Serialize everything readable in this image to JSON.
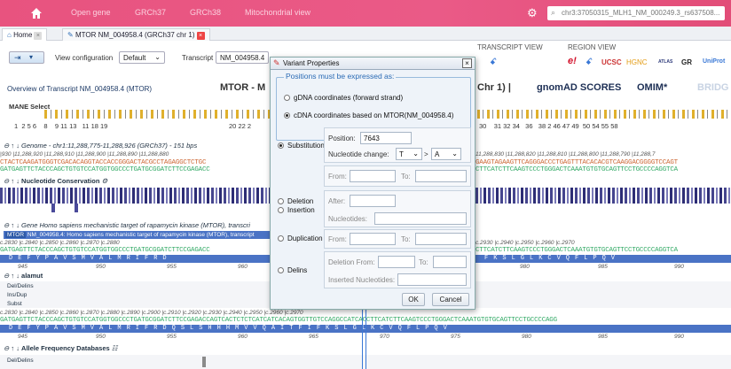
{
  "topbar": {
    "nav": [
      "Open gene",
      "GRCh37",
      "GRCh38",
      "Mitochondrial view"
    ],
    "search": "chr3:37050315_MLH1_NM_000249.3_rs637508..."
  },
  "tabs": [
    {
      "label": "Home"
    },
    {
      "label": "MTOR NM_004958.4 (GRCh37 chr 1)"
    }
  ],
  "toolbar": {
    "view_config_label": "View configuration",
    "view_config_value": "Default",
    "transcript_label": "Transcript",
    "transcript_value": "NM_004958.4",
    "transcript_view": "TRANSCRIPT VIEW",
    "region_view": "REGION VIEW",
    "links": [
      "UCSC",
      "HGNC",
      "ATLAS",
      "GR",
      "UniProt"
    ]
  },
  "overview": {
    "title": "Overview of Transcript NM_004958.4 (MTOR)",
    "gene": "MTOR - M",
    "chr": "Chr 1) |",
    "gnomad": "gnomAD SCORES",
    "omim": "OMIM*",
    "bridge": "BRIDG",
    "mane": "MANE Select"
  },
  "exons_left": [
    "1",
    "2",
    "5",
    "6",
    "8",
    "9",
    "11",
    "13",
    "11",
    "18",
    "19"
  ],
  "exons_right": [
    "20",
    "22",
    "2",
    "30",
    "31",
    "32",
    "34",
    "36",
    "38",
    "2",
    "46",
    "47",
    "49",
    "50",
    "54",
    "55",
    "58"
  ],
  "tracks": {
    "genome": "Genome - chr1:11,288,775-11,288,926 (GRCh37) - 151 bps",
    "conservation": "Nucleotide Conservation",
    "gene": "Gene Homo sapiens mechanistic target of rapamycin kinase (MTOR), transcri",
    "gene_banner": "NM_004958.4: Homo sapiens mechanistic target of rapamycin kinase (MTOR), transcript",
    "alamut": "alamut",
    "alamut_rows": [
      "Del/Delins",
      "Ins/Dup",
      "Subst"
    ],
    "allele": "Allele Frequency Databases",
    "allele_rows": [
      "Del/Delins"
    ],
    "mtor_badge": "MTOR"
  },
  "genome_ruler": "|930        |11,288,920        |11,288,910        |11,288,900        |11,288,890        |11,288,880",
  "genome_ruler_r": "11,288,830        |11,288,820        |11,288,810        |11,288,800        |11,288,790        |11,288,7",
  "seq_top": "CTACTCAAGATGGGTCGACACAGGTACCACCGGGACTACGCCTAGAGGCTCTGC",
  "seq_bot": "GATGAGTTCTACCCAGCTGTGTCCATGGTGGCCCTGATGCGGATCTTCCGAGACC",
  "seq_top_r": "GAAGTAGAAGTTCAGGGACCCTGAGTTTACACACGTCAAGGACGGGGTCCAGT",
  "seq_bot_r": "CTTCATCTTCAAGTCCCTGGGACTCAAATGTGTGCAGTTCCTGCCCCAGGTCA",
  "aa_left": "DEFYPAVSMVALMRIFRD",
  "aa_right": "FKSLGLKCVQFLPQV",
  "aa_nums_left": [
    "945",
    "950",
    "955",
    "960"
  ],
  "aa_nums_right": [
    "980",
    "985",
    "990"
  ],
  "c_ruler": "c.2830        |c.2840        |c.2850        |c.2860        |c.2870        |c.2880",
  "c_ruler_r": "c.2930        |c.2940        |c.2950        |c.2960        |c.2970",
  "c_ruler2": "c.2830     |c.2840     |c.2850     |c.2860     |c.2870     |c.2880     |c.2890     |c.2900     |c.2910     |c.2920     |c.2930     |c.2940     |c.2950     |c.2960     |c.2970",
  "seq_bot2": "GATGAGTTCTACCCAGCTGTGTCCATGGTGGCCCTGATGCGGATCTTCCGAGACCAGTCACTCTCTCATCATCACAGTGGTTGTCCAGGCCATCACCTTCATCTTCAAGTCCCTGGGACTCAAATGTGTGCAGTTCCTGCCCCAGG",
  "aa2": "DEFYPAVSMVALMRIFRDQSLSHHHMVVQAITFIFKSLGLKCVQFLPQV",
  "aa2_nums": [
    "945",
    "950",
    "955",
    "960",
    "965",
    "970",
    "975",
    "980",
    "985",
    "990"
  ],
  "dialog": {
    "title": "Variant Properties",
    "legend": "Positions must be expressed as:",
    "coord_options": [
      "gDNA coordinates (forward strand)",
      "cDNA coordinates based on MTOR(NM_004958.4)"
    ],
    "types": [
      "Substitution",
      "Deletion",
      "Insertion",
      "Duplication",
      "Delins"
    ],
    "position_label": "Position:",
    "position_value": "7643",
    "nuc_change_label": "Nucleotide change:",
    "from_nuc": "T",
    "to_nuc": "A",
    "from_label": "From:",
    "to_label": "To:",
    "after_label": "After:",
    "nucleotides_label": "Nucleotides:",
    "deletion_from_label": "Deletion From:",
    "inserted_label": "Inserted Nucleotides:",
    "ok": "OK",
    "cancel": "Cancel"
  }
}
